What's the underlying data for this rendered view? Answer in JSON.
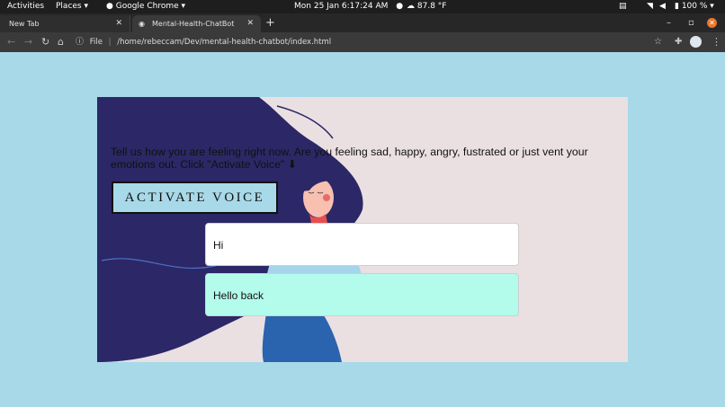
{
  "topbar": {
    "activities": "Activities",
    "places": "Places",
    "app": "Google Chrome",
    "datetime": "Mon 25 Jan  6:17:24 AM",
    "weather": "87.8 °F",
    "battery": "100 %"
  },
  "tabs": [
    {
      "label": "New Tab"
    },
    {
      "label": "Mental-Health-ChatBot"
    }
  ],
  "address": {
    "scheme": "File",
    "url": "/home/rebeccam/Dev/mental-health-chatbot/index.html"
  },
  "main": {
    "prompt": "Tell us how you are feeling right now. Are you feeling sad, happy, angry, fustrated or just vent your emotions out. Click \"Activate Voice\" ⬇",
    "activate_label": "ACTIVATE VOICE",
    "messages": [
      {
        "role": "user",
        "text": "Hi"
      },
      {
        "role": "bot",
        "text": "Hello back"
      }
    ]
  },
  "colors": {
    "page_bg": "#a8d9e8",
    "card_bg": "#eae0e2",
    "hair": "#2c2766",
    "bot_bubble": "#b3fbea",
    "accent_orange": "#e8772e"
  }
}
